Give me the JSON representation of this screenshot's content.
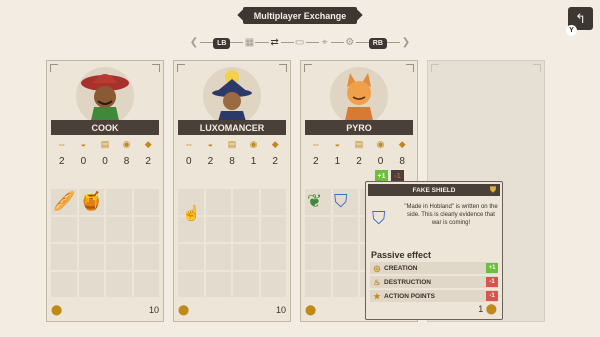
{
  "header": {
    "title": "Multiplayer Exchange",
    "left_bumper": "LB",
    "right_bumper": "RB",
    "back_key": "Y"
  },
  "stat_icons": [
    "arrows-icon",
    "mask-icon",
    "scroll-icon",
    "coin-icon",
    "drop-icon"
  ],
  "characters": [
    {
      "name": "COOK",
      "stats": [
        "2",
        "0",
        "0",
        "8",
        "2"
      ],
      "gold": "10"
    },
    {
      "name": "LUXOMANCER",
      "stats": [
        "0",
        "2",
        "8",
        "1",
        "2"
      ],
      "gold": "10"
    },
    {
      "name": "PYRO",
      "stats": [
        "2",
        "1",
        "2",
        "0",
        "8"
      ],
      "gold": ""
    }
  ],
  "pyro_changes": {
    "plus": "+1",
    "minus": "-1"
  },
  "tooltip": {
    "title": "FAKE SHIELD",
    "description": "\"Made in Hobland\" is written on the side. This is clearly evidence that war is coming!",
    "section": "Passive effect",
    "effects": [
      {
        "label": "CREATION",
        "badge": "+1",
        "color": "#6cbf3a"
      },
      {
        "label": "DESTRUCTION",
        "badge": "-1",
        "color": "#d9534f"
      },
      {
        "label": "ACTION POINTS",
        "badge": "-1",
        "color": "#d9534f"
      }
    ],
    "gold": "1"
  },
  "colors": {
    "dark": "#3c3732",
    "gold": "#c08a1a",
    "plus": "#6cbf3a",
    "minus": "#d9534f"
  }
}
